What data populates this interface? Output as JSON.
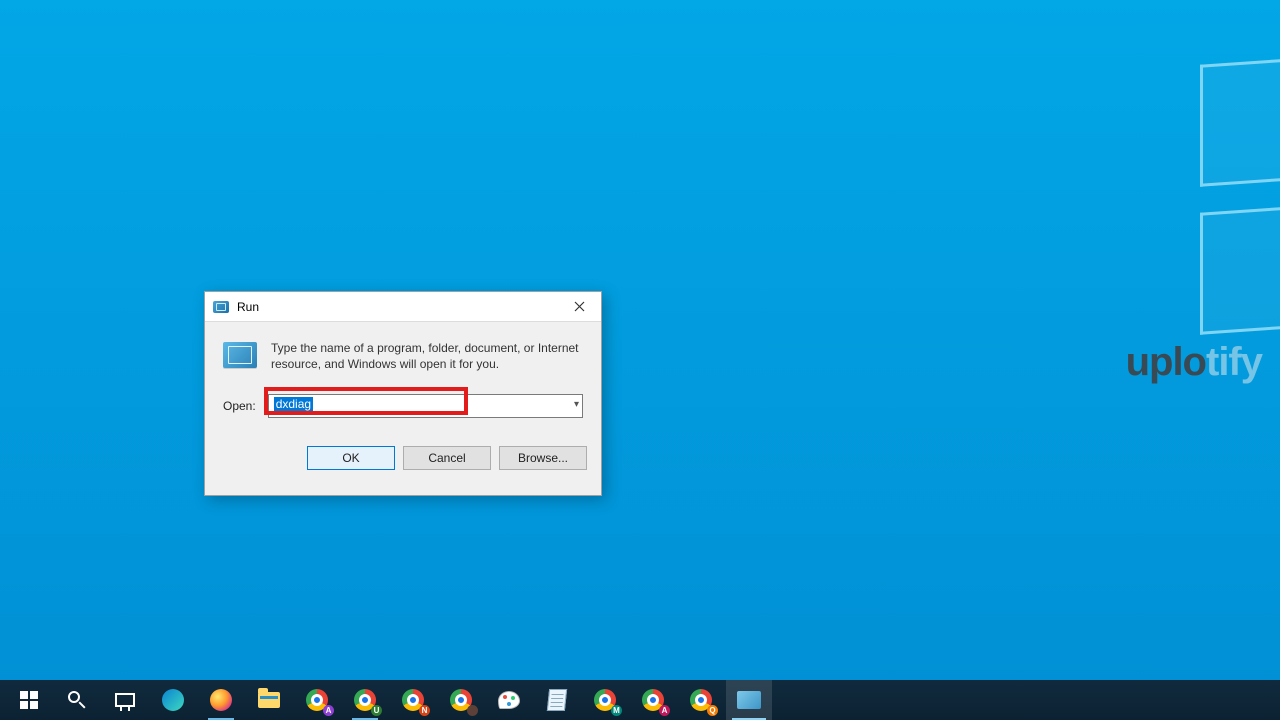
{
  "watermark": {
    "dark": "uplo",
    "light": "tify"
  },
  "dialog": {
    "title": "Run",
    "description": "Type the name of a program, folder, document, or Internet resource, and Windows will open it for you.",
    "open_label": "Open:",
    "input_value": "dxdiag",
    "buttons": {
      "ok": "OK",
      "cancel": "Cancel",
      "browse": "Browse..."
    }
  },
  "taskbar": {
    "chrome_badges": [
      "A",
      "",
      "N",
      "U",
      "",
      "M",
      "A",
      "Q"
    ]
  }
}
